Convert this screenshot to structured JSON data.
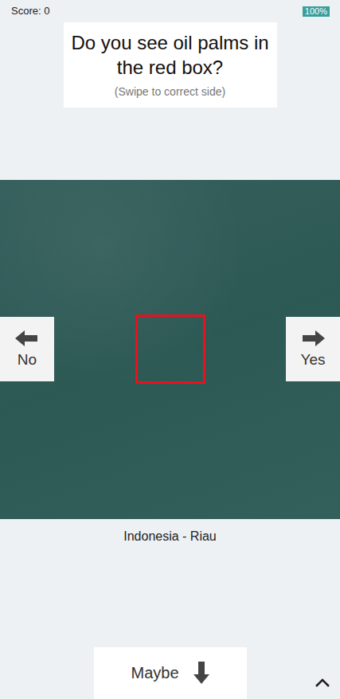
{
  "status_bar": {
    "score": "Score: 0",
    "battery": "100%"
  },
  "question": {
    "title": "Do you see oil palms in the red box?",
    "hint": "(Swipe to correct side)"
  },
  "image": {
    "location": "Indonesia - Riau"
  },
  "answers": {
    "no": "No",
    "yes": "Yes",
    "maybe": "Maybe"
  }
}
